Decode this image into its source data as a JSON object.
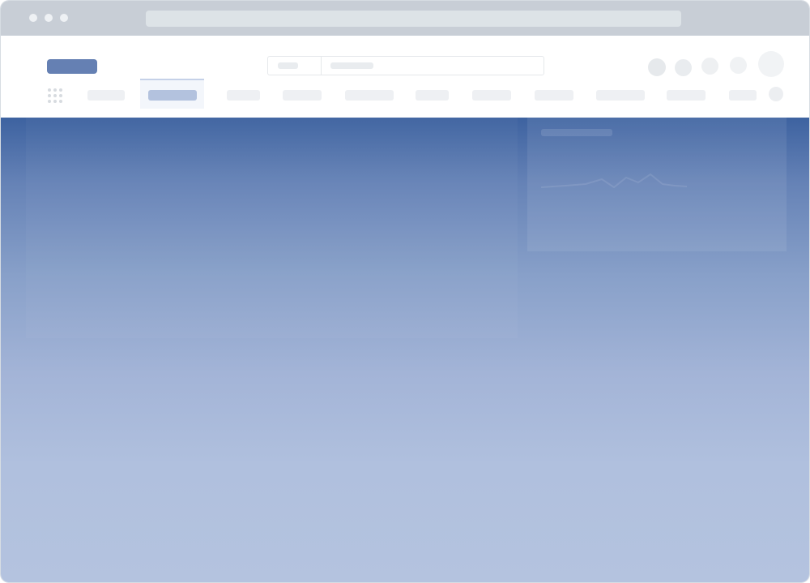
{
  "browser": {
    "window_controls": [
      "close",
      "minimize",
      "maximize"
    ],
    "address_bar_value": ""
  },
  "header": {
    "logo_text": "",
    "search": {
      "scope_value": "",
      "placeholder": ""
    },
    "icons": [
      "notification-icon",
      "help-icon",
      "settings-icon",
      "messages-icon",
      "avatar"
    ]
  },
  "nav": {
    "items": [
      {
        "label": ""
      },
      {
        "label": "",
        "active": true
      },
      {
        "label": ""
      },
      {
        "label": ""
      },
      {
        "label": ""
      },
      {
        "label": ""
      },
      {
        "label": ""
      },
      {
        "label": ""
      },
      {
        "label": ""
      },
      {
        "label": ""
      },
      {
        "label": ""
      }
    ]
  },
  "colors": {
    "brand": "#6580b3",
    "active_tab": "#b3c2de",
    "hero_top": "#3d62a0",
    "hero_bottom": "#b4c3df"
  }
}
